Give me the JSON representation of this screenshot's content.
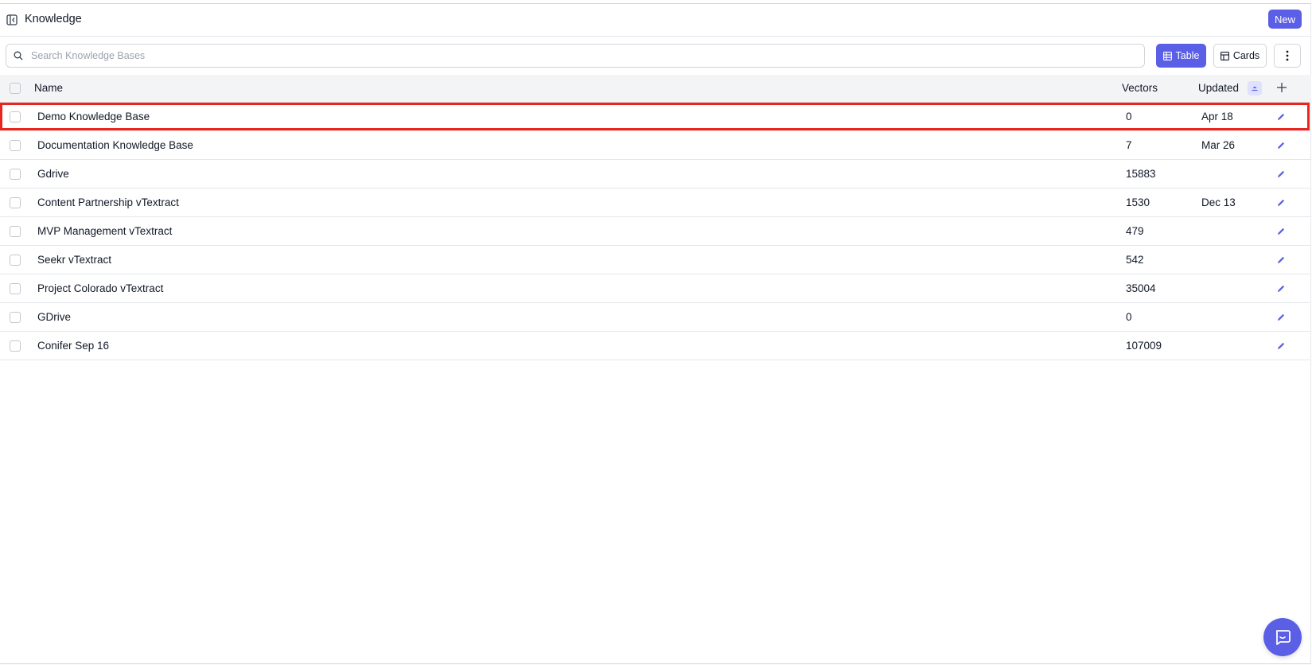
{
  "header": {
    "title": "Knowledge",
    "new_label": "New"
  },
  "toolbar": {
    "search_placeholder": "Search Knowledge Bases",
    "search_value": "",
    "table_label": "Table",
    "cards_label": "Cards",
    "active_view": "Table"
  },
  "table": {
    "columns": {
      "name": "Name",
      "vectors": "Vectors",
      "updated": "Updated"
    },
    "rows": [
      {
        "name": "Demo Knowledge Base",
        "vectors": "0",
        "updated": "Apr 18",
        "highlighted": true
      },
      {
        "name": "Documentation Knowledge Base",
        "vectors": "7",
        "updated": "Mar 26"
      },
      {
        "name": "Gdrive",
        "vectors": "15883",
        "updated": ""
      },
      {
        "name": "Content Partnership vTextract",
        "vectors": "1530",
        "updated": "Dec 13"
      },
      {
        "name": "MVP Management vTextract",
        "vectors": "479",
        "updated": ""
      },
      {
        "name": "Seekr vTextract",
        "vectors": "542",
        "updated": ""
      },
      {
        "name": "Project Colorado vTextract",
        "vectors": "35004",
        "updated": ""
      },
      {
        "name": "GDrive",
        "vectors": "0",
        "updated": ""
      },
      {
        "name": "Conifer Sep 16",
        "vectors": "107009",
        "updated": ""
      }
    ]
  },
  "icons": {
    "sidebar_toggle": "sidebar-collapse-icon",
    "search": "search-icon",
    "table_view": "table-grid-icon",
    "cards_view": "cards-layout-icon",
    "more": "more-vertical-icon",
    "sort": "sort-icon",
    "add_column": "plus-icon",
    "edit": "pencil-icon",
    "chat": "chat-bubble-icon"
  },
  "colors": {
    "accent": "#5b5fe6",
    "highlight": "#e8261d",
    "header_bg": "#f3f4f6"
  }
}
